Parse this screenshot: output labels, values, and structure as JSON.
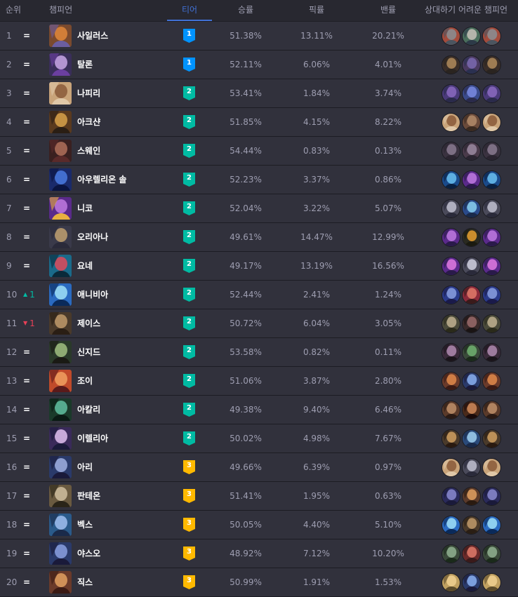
{
  "header": {
    "rank": "순위",
    "champion": "챔피언",
    "tier": "티어",
    "winrate": "승률",
    "pickrate": "픽률",
    "banrate": "밴률",
    "counters": "상대하기 어려운 챔피언"
  },
  "colors": {
    "tier1": "#0093ff",
    "tier2": "#00bba3",
    "tier3": "#ffb900",
    "active": "#4171d6",
    "up": "#00bba3",
    "down": "#e84057"
  },
  "rows": [
    {
      "rank": "1",
      "change": "=",
      "dir": "same",
      "name": "사일러스",
      "tier": "1",
      "win": "51.38%",
      "pick": "13.11%",
      "ban": "20.21%",
      "c": [
        "#7a4a2e",
        "#e0873a",
        "#6b5ea0",
        "#a34b3c",
        "#8a8f94",
        "#4b5560",
        "#4a6e5c",
        "#c7c2b8",
        "#2d3a48"
      ],
      "counters": [
        "counter-champion-icon",
        "counter-champion-icon",
        "counter-champion-icon"
      ]
    },
    {
      "rank": "2",
      "change": "=",
      "dir": "same",
      "name": "탈론",
      "tier": "1",
      "win": "52.11%",
      "pick": "6.06%",
      "ban": "4.01%",
      "c": [
        "#3a2e5a",
        "#c9a6e8",
        "#6b3fa0",
        "#3a2e28",
        "#b08a5a",
        "#2a2420",
        "#4a3a60",
        "#7a6ab0",
        "#2a3050"
      ],
      "counters": [
        "counter-champion-icon",
        "counter-champion-icon",
        "counter-champion-icon"
      ]
    },
    {
      "rank": "3",
      "change": "=",
      "dir": "same",
      "name": "나피리",
      "tier": "2",
      "win": "53.41%",
      "pick": "1.84%",
      "ban": "3.74%",
      "c": [
        "#c9a47a",
        "#8a5a3a",
        "#e0c8a8",
        "#4a3a7a",
        "#8a6ac0",
        "#2a2a4a",
        "#3a4a8a",
        "#7a8ae0",
        "#2a2a4a"
      ],
      "counters": [
        "counter-champion-icon",
        "counter-champion-icon",
        "counter-champion-icon"
      ]
    },
    {
      "rank": "4",
      "change": "=",
      "dir": "same",
      "name": "아크샨",
      "tier": "2",
      "win": "51.85%",
      "pick": "4.15%",
      "ban": "8.22%",
      "c": [
        "#5a3a1e",
        "#d8a24a",
        "#2a1e14",
        "#c9a47a",
        "#8a5a3a",
        "#e0c8a8",
        "#6a4a3a",
        "#b08a6a",
        "#3a2a20"
      ],
      "counters": [
        "counter-champion-icon",
        "counter-champion-icon",
        "counter-champion-icon"
      ]
    },
    {
      "rank": "5",
      "change": "=",
      "dir": "same",
      "name": "스웨인",
      "tier": "2",
      "win": "54.44%",
      "pick": "0.83%",
      "ban": "0.13%",
      "c": [
        "#3a2020",
        "#b0705a",
        "#5a2a2a",
        "#3a3240",
        "#8a7a90",
        "#2a2430",
        "#4a3a4a",
        "#9a8aa0",
        "#2a2430"
      ],
      "counters": [
        "counter-champion-icon",
        "counter-champion-icon",
        "counter-champion-icon"
      ]
    },
    {
      "rank": "6",
      "change": "=",
      "dir": "same",
      "name": "아우렐리온 솔",
      "tier": "2",
      "win": "52.23%",
      "pick": "3.37%",
      "ban": "0.86%",
      "c": [
        "#1a2a6a",
        "#4a7ae0",
        "#0a1440",
        "#1a4a8a",
        "#6ac0f0",
        "#0a2040",
        "#5a2a8a",
        "#c07ae0",
        "#2a1a4a"
      ],
      "counters": [
        "counter-champion-icon",
        "counter-champion-icon",
        "counter-champion-icon"
      ]
    },
    {
      "rank": "7",
      "change": "=",
      "dir": "same",
      "name": "니코",
      "tier": "2",
      "win": "52.04%",
      "pick": "3.22%",
      "ban": "5.07%",
      "c": [
        "#5a2a8a",
        "#c07ae0",
        "#e8b040",
        "#4a4a5a",
        "#c0c0d0",
        "#2a2a3a",
        "#2a4a8a",
        "#8ad0f0",
        "#1a2a4a"
      ],
      "counters": [
        "counter-champion-icon",
        "counter-champion-icon",
        "counter-champion-icon"
      ]
    },
    {
      "rank": "8",
      "change": "=",
      "dir": "same",
      "name": "오리아나",
      "tier": "2",
      "win": "49.61%",
      "pick": "14.47%",
      "ban": "12.99%",
      "c": [
        "#3a3a4a",
        "#c0a070",
        "#2a2a3a",
        "#5a2a8a",
        "#c07ae0",
        "#2a1a4a",
        "#2a2a20",
        "#e8a030",
        "#1a1a10"
      ],
      "counters": [
        "counter-champion-icon",
        "counter-champion-icon",
        "counter-champion-icon"
      ]
    },
    {
      "rank": "9",
      "change": "=",
      "dir": "same",
      "name": "요네",
      "tier": "2",
      "win": "49.17%",
      "pick": "13.19%",
      "ban": "16.56%",
      "c": [
        "#1a6a8a",
        "#e04a5a",
        "#0a2a3a",
        "#5a2a8a",
        "#e07ae0",
        "#2a1a4a",
        "#4a4a5a",
        "#d0d0e0",
        "#2a2a3a"
      ],
      "counters": [
        "counter-champion-icon",
        "counter-champion-icon",
        "counter-champion-icon"
      ]
    },
    {
      "rank": "10",
      "change": "1",
      "dir": "up",
      "name": "애니비아",
      "tier": "2",
      "win": "52.44%",
      "pick": "2.41%",
      "ban": "1.24%",
      "c": [
        "#2a6ac0",
        "#a0e0f8",
        "#0a2a5a",
        "#2a3a8a",
        "#8aa0e0",
        "#1a1a4a",
        "#8a2a3a",
        "#e07a6a",
        "#3a1a1a"
      ],
      "counters": [
        "counter-champion-icon",
        "counter-champion-icon",
        "counter-champion-icon"
      ]
    },
    {
      "rank": "11",
      "change": "1",
      "dir": "down",
      "name": "제이스",
      "tier": "2",
      "win": "50.72%",
      "pick": "6.04%",
      "ban": "3.05%",
      "c": [
        "#4a3a2a",
        "#c09a6a",
        "#2a1e14",
        "#4a4a3a",
        "#c0b090",
        "#2a2a1a",
        "#3a2a2a",
        "#9a6a6a",
        "#1a1414"
      ],
      "counters": [
        "counter-champion-icon",
        "counter-champion-icon",
        "counter-champion-icon"
      ]
    },
    {
      "rank": "12",
      "change": "=",
      "dir": "same",
      "name": "신지드",
      "tier": "2",
      "win": "53.58%",
      "pick": "0.82%",
      "ban": "0.11%",
      "c": [
        "#2a3a2a",
        "#a0c080",
        "#1a1a14",
        "#3a2a3a",
        "#b08ab0",
        "#1a141a",
        "#3a4a3a",
        "#70b070",
        "#1a2a1a"
      ],
      "counters": [
        "counter-champion-icon",
        "counter-champion-icon",
        "counter-champion-icon"
      ]
    },
    {
      "rank": "13",
      "change": "=",
      "dir": "same",
      "name": "조이",
      "tier": "2",
      "win": "51.06%",
      "pick": "3.87%",
      "ban": "2.80%",
      "c": [
        "#c04a2a",
        "#f0a060",
        "#5a1a1a",
        "#6a3a2a",
        "#e08a4a",
        "#3a1a14",
        "#2a3a6a",
        "#8ab0f0",
        "#1a1a3a"
      ],
      "counters": [
        "counter-champion-icon",
        "counter-champion-icon",
        "counter-champion-icon"
      ]
    },
    {
      "rank": "14",
      "change": "=",
      "dir": "same",
      "name": "아칼리",
      "tier": "2",
      "win": "49.38%",
      "pick": "9.40%",
      "ban": "6.46%",
      "c": [
        "#1a3a2a",
        "#60c0a0",
        "#0a1a14",
        "#5a3a2a",
        "#c0906a",
        "#2a1a14",
        "#4a2a1a",
        "#d08a5a",
        "#1a0a0a"
      ],
      "counters": [
        "counter-champion-icon",
        "counter-champion-icon",
        "counter-champion-icon"
      ]
    },
    {
      "rank": "15",
      "change": "=",
      "dir": "same",
      "name": "이렐리아",
      "tier": "2",
      "win": "50.02%",
      "pick": "4.98%",
      "ban": "7.67%",
      "c": [
        "#3a2a5a",
        "#e0c0f0",
        "#1a1a3a",
        "#4a3a2a",
        "#d0a060",
        "#2a1a10",
        "#2a4a7a",
        "#a0d0f0",
        "#1a2a4a"
      ],
      "counters": [
        "counter-champion-icon",
        "counter-champion-icon",
        "counter-champion-icon"
      ]
    },
    {
      "rank": "16",
      "change": "=",
      "dir": "same",
      "name": "아리",
      "tier": "3",
      "win": "49.66%",
      "pick": "6.39%",
      "ban": "0.97%",
      "c": [
        "#2a3a6a",
        "#a0b0e0",
        "#1a1a3a",
        "#c9a47a",
        "#8a5a3a",
        "#e0c8a8",
        "#4a4a5a",
        "#c0c0d0",
        "#2a2a3a"
      ],
      "counters": [
        "counter-champion-icon",
        "counter-champion-icon",
        "counter-champion-icon"
      ]
    },
    {
      "rank": "17",
      "change": "=",
      "dir": "same",
      "name": "판테온",
      "tier": "3",
      "win": "51.41%",
      "pick": "1.95%",
      "ban": "0.63%",
      "c": [
        "#6a5a40",
        "#d0c0a0",
        "#2a2418",
        "#2a2a5a",
        "#8a8ad0",
        "#1a1a3a",
        "#5a3a2a",
        "#e0a060",
        "#2a1a10"
      ],
      "counters": [
        "counter-champion-icon",
        "counter-champion-icon",
        "counter-champion-icon"
      ]
    },
    {
      "rank": "18",
      "change": "=",
      "dir": "same",
      "name": "벡스",
      "tier": "3",
      "win": "50.05%",
      "pick": "4.40%",
      "ban": "5.10%",
      "c": [
        "#2a5a8a",
        "#a0c0f0",
        "#1a2a4a",
        "#2a6ac0",
        "#a0e0f8",
        "#0a2a5a",
        "#4a3a2a",
        "#c09a6a",
        "#2a1e14"
      ],
      "counters": [
        "counter-champion-icon",
        "counter-champion-icon",
        "counter-champion-icon"
      ]
    },
    {
      "rank": "19",
      "change": "=",
      "dir": "same",
      "name": "야스오",
      "tier": "3",
      "win": "48.92%",
      "pick": "7.12%",
      "ban": "10.20%",
      "c": [
        "#2a3a6a",
        "#8aa0e0",
        "#1a1a3a",
        "#3a4a3a",
        "#90b090",
        "#1a2a1a",
        "#6a2a2a",
        "#e07a6a",
        "#3a1a1a"
      ],
      "counters": [
        "counter-champion-icon",
        "counter-champion-icon",
        "counter-champion-icon"
      ]
    },
    {
      "rank": "20",
      "change": "=",
      "dir": "same",
      "name": "직스",
      "tier": "3",
      "win": "50.99%",
      "pick": "1.91%",
      "ban": "1.53%",
      "c": [
        "#6a3a2a",
        "#e0a060",
        "#3a1a14",
        "#c0a060",
        "#f0d090",
        "#5a4a2a",
        "#2a3a6a",
        "#8ab0f0",
        "#1a1a3a"
      ],
      "counters": [
        "counter-champion-icon",
        "counter-champion-icon",
        "counter-champion-icon"
      ]
    }
  ]
}
